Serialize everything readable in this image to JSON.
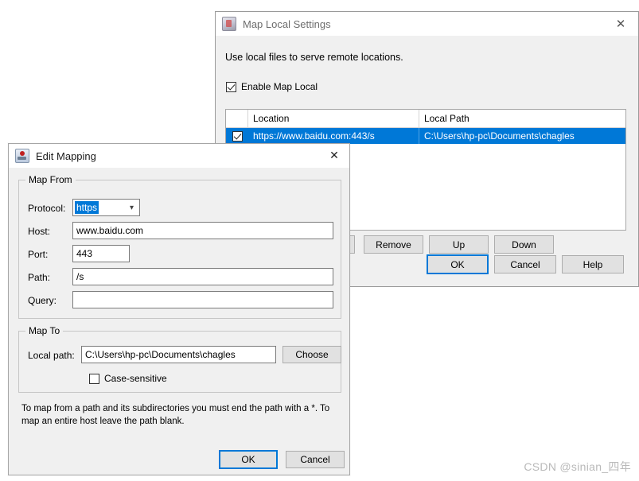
{
  "map_local_settings": {
    "title": "Map Local Settings",
    "icon": "charles-bottle-icon",
    "close_label": "✕",
    "subtitle": "Use local files to serve remote locations.",
    "enable_checkbox": {
      "label": "Enable Map Local",
      "checked": true
    },
    "table": {
      "columns": [
        "",
        "Location",
        "Local Path"
      ],
      "rows": [
        {
          "enabled": true,
          "location": "https://www.baidu.com:443/s",
          "local_path": "C:\\Users\\hp-pc\\Documents\\chagles",
          "selected": true
        }
      ]
    },
    "list_buttons": [
      "Remove",
      "Up",
      "Down"
    ],
    "dialog_buttons": [
      {
        "label": "OK",
        "default": true
      },
      {
        "label": "Cancel",
        "default": false
      },
      {
        "label": "Help",
        "default": false
      }
    ]
  },
  "edit_mapping": {
    "title": "Edit Mapping",
    "icon": "charles-app-icon",
    "close_label": "✕",
    "map_from": {
      "legend": "Map From",
      "fields": [
        {
          "label": "Protocol:",
          "value": "https",
          "type": "select",
          "selected_highlight": true
        },
        {
          "label": "Host:",
          "value": "www.baidu.com",
          "type": "text"
        },
        {
          "label": "Port:",
          "value": "443",
          "type": "text"
        },
        {
          "label": "Path:",
          "value": "/s",
          "type": "text"
        },
        {
          "label": "Query:",
          "value": "",
          "type": "text"
        }
      ]
    },
    "map_to": {
      "legend": "Map To",
      "local_path_label": "Local path:",
      "local_path_value": "C:\\Users\\hp-pc\\Documents\\chagles",
      "choose_label": "Choose",
      "case_sensitive": {
        "label": "Case-sensitive",
        "checked": false
      }
    },
    "hint": "To map from a path and its subdirectories you must end the path with a *. To map an entire host leave the path blank.",
    "buttons": [
      {
        "label": "OK",
        "default": true
      },
      {
        "label": "Cancel",
        "default": false
      }
    ]
  },
  "watermark": "CSDN @sinian_四年",
  "colors": {
    "accent": "#0078d7",
    "window_bg": "#f0f0f0",
    "titlebar_bg": "#ffffff",
    "button_bg": "#e1e1e1",
    "selection_blue": "#0078d7"
  }
}
